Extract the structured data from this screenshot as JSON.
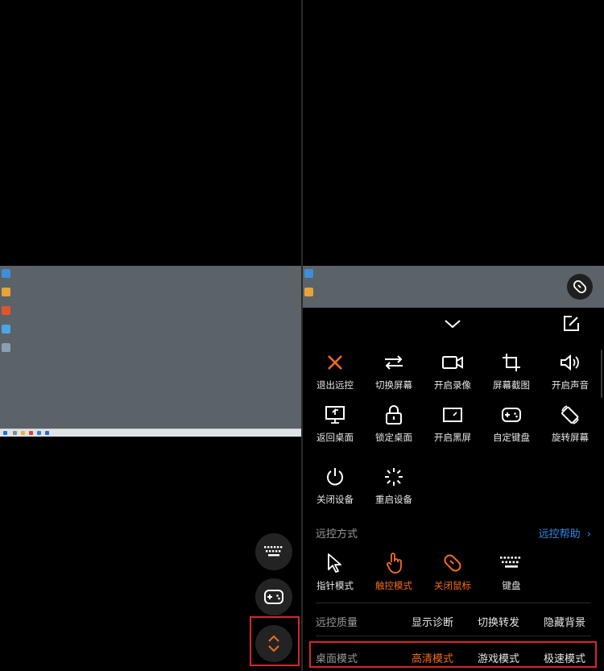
{
  "colors": {
    "accent": "#f26c21",
    "link": "#2f8ae5",
    "highlight": "#d9262c",
    "desktop": "#5b6268"
  },
  "left": {
    "fab_icons": [
      "keyboard-icon",
      "gamepad-icon",
      "expand-toggle-icon"
    ]
  },
  "panel": {
    "grid": [
      {
        "label": "退出远控",
        "icon": "close-icon"
      },
      {
        "label": "切换屏幕",
        "icon": "switch-arrows-icon"
      },
      {
        "label": "开启录像",
        "icon": "video-camera-icon"
      },
      {
        "label": "屏幕截图",
        "icon": "crop-icon"
      },
      {
        "label": "开启声音",
        "icon": "speaker-icon"
      },
      {
        "label": "返回桌面",
        "icon": "monitor-return-icon"
      },
      {
        "label": "锁定桌面",
        "icon": "lock-icon"
      },
      {
        "label": "开启黑屏",
        "icon": "black-screen-icon"
      },
      {
        "label": "自定键盘",
        "icon": "gamepad-icon"
      },
      {
        "label": "旋转屏幕",
        "icon": "rotate-screen-icon"
      },
      {
        "label": "关闭设备",
        "icon": "power-icon"
      },
      {
        "label": "重启设备",
        "icon": "restart-spinner-icon"
      }
    ],
    "control_mode": {
      "label": "远控方式",
      "help": "远控帮助",
      "options": [
        {
          "label": "指针模式",
          "icon": "pointer-icon",
          "active": false
        },
        {
          "label": "触控模式",
          "icon": "touch-icon",
          "active": true
        },
        {
          "label": "关闭鼠标",
          "icon": "mouse-icon",
          "active": true
        },
        {
          "label": "键盘",
          "icon": "keyboard-icon",
          "active": false
        }
      ]
    },
    "quality": {
      "label": "远控质量",
      "options": [
        "显示诊断",
        "切换转发",
        "隐藏背景"
      ]
    },
    "desktop_mode": {
      "label": "桌面模式",
      "options": [
        {
          "label": "高清模式",
          "active": true
        },
        {
          "label": "游戏模式",
          "active": false
        },
        {
          "label": "极速模式",
          "active": false
        }
      ]
    }
  }
}
